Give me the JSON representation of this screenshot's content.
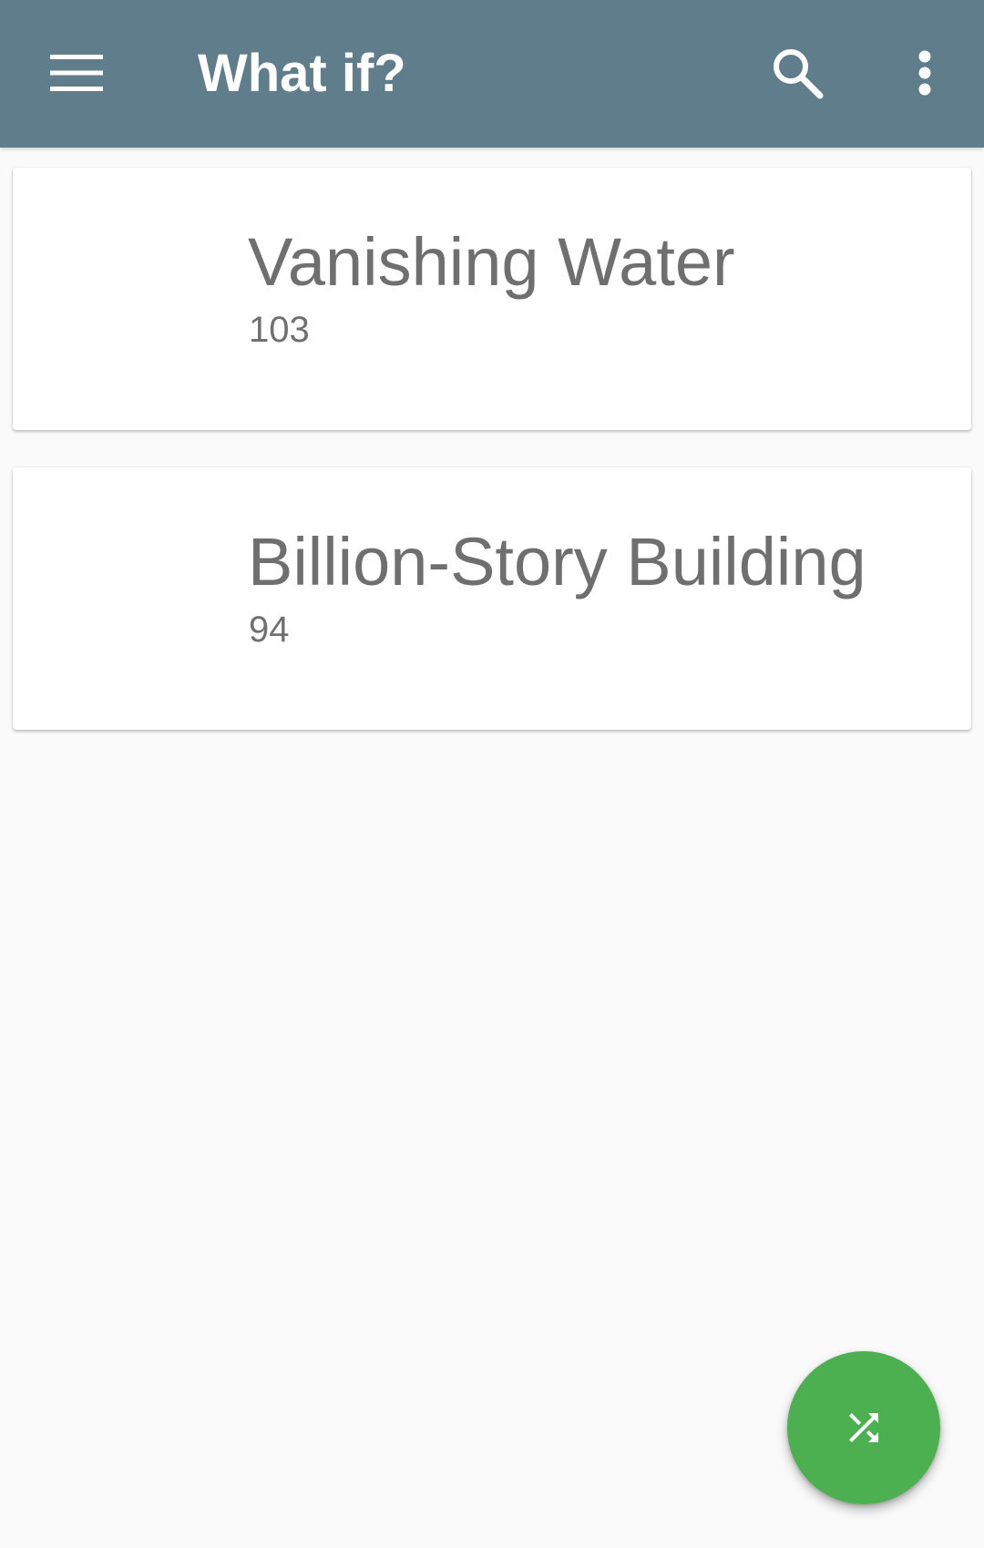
{
  "app_bar": {
    "title": "What if?",
    "background_color": "#607d8b",
    "nav_icon": "menu-icon",
    "search_icon": "search-icon",
    "overflow_icon": "more-vert-icon"
  },
  "articles": [
    {
      "title": "Vanishing Water",
      "number": "103"
    },
    {
      "title": "Billion-Story Building",
      "number": "94"
    }
  ],
  "fab": {
    "icon": "shuffle-icon",
    "color": "#4caf50"
  }
}
